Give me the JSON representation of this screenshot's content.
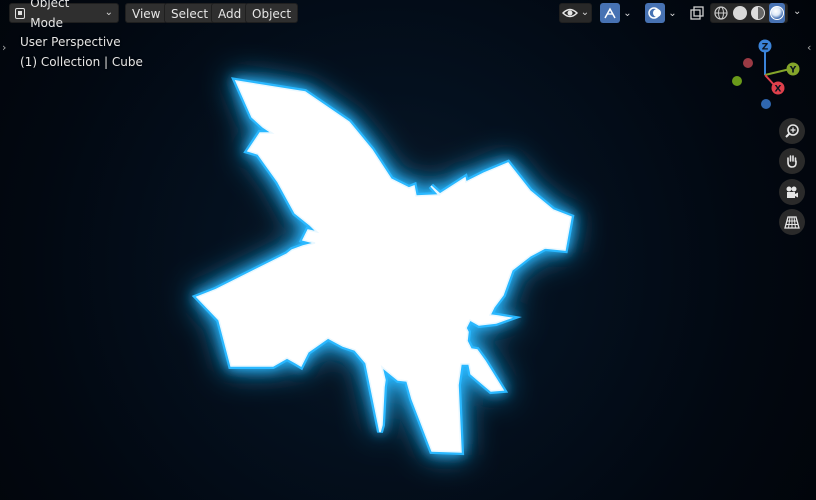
{
  "header": {
    "mode_label": "Object Mode",
    "menus": [
      "View",
      "Select",
      "Add",
      "Object"
    ]
  },
  "viewport": {
    "perspective_label": "User Perspective",
    "collection_label": "(1) Collection | Cube"
  },
  "gizmo": {
    "axes": [
      "Z",
      "Y",
      "X"
    ]
  },
  "colors": {
    "accent": "#4772b3",
    "glow": "#2ab8ff",
    "x_axis": "#e0404c",
    "y_axis": "#84a52a",
    "z_axis": "#3b83d9"
  }
}
